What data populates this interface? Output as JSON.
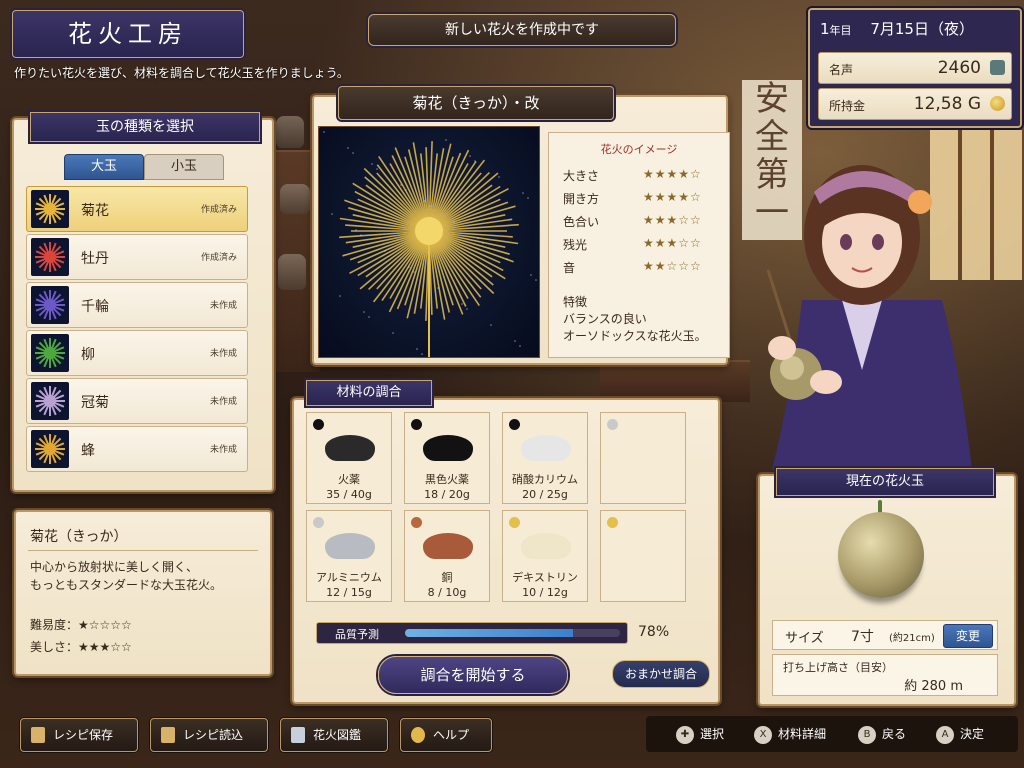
{
  "title": "花火工房",
  "subtitle": "作りたい花火を選び、材料を調合して花火玉を作りましょう。",
  "banner": "新しい花火を作成中です",
  "status": {
    "year": "1",
    "year_unit": "年目",
    "date": "7月15日（夜）",
    "fame_label": "名声",
    "fame_value": "2460",
    "money_label": "所持金",
    "money_value": "12,58 G"
  },
  "left": {
    "title": "玉の種類を選択",
    "tabs": [
      "大玉",
      "小玉"
    ],
    "items": [
      {
        "name": "菊花",
        "state": "作成済み",
        "color": "#e6b43a"
      },
      {
        "name": "牡丹",
        "state": "作成済み",
        "color": "#d9453a"
      },
      {
        "name": "千輪",
        "state": "未作成",
        "color": "#6d58c8"
      },
      {
        "name": "柳",
        "state": "未作成",
        "color": "#4ea83e"
      },
      {
        "name": "冠菊",
        "state": "未作成",
        "color": "#b7a2d2"
      },
      {
        "name": "蜂",
        "state": "未作成",
        "color": "#e0a832"
      }
    ]
  },
  "desc": {
    "name": "菊花（きっか）",
    "text": "中心から放射状に美しく開く、\nもっともスタンダードな大玉花火。",
    "difficulty_label": "難易度：",
    "difficulty_stars": "★☆☆☆☆",
    "beauty_label": "美しさ：",
    "beauty_stars": "★★★☆☆"
  },
  "firework": {
    "name": "菊花（きっか）・改",
    "image_title": "花火のイメージ",
    "attrs": [
      {
        "label": "大きさ",
        "stars": "★★★★☆"
      },
      {
        "label": "開き方",
        "stars": "★★★★☆"
      },
      {
        "label": "色合い",
        "stars": "★★★☆☆"
      },
      {
        "label": "残光",
        "stars": "★★★☆☆"
      },
      {
        "label": "音",
        "stars": "★★☆☆☆"
      }
    ],
    "feature_title": "特徴",
    "feature_text": "バランスの良い\nオーソドックスな花火玉。"
  },
  "mix": {
    "title": "材料の調合",
    "materials": [
      {
        "name": "火薬",
        "qty": "35 / 40g",
        "dot": "#111111",
        "pile": "#2a2a2a"
      },
      {
        "name": "黒色火薬",
        "qty": "18 / 20g",
        "dot": "#111111",
        "pile": "#121212"
      },
      {
        "name": "硝酸カリウム",
        "qty": "20 / 25g",
        "dot": "#111111",
        "pile": "#e6e6e6"
      },
      {
        "name": "",
        "qty": "",
        "dot": "#c9c9c9",
        "pile": ""
      },
      {
        "name": "アルミニウム",
        "qty": "12 / 15g",
        "dot": "#c9c9c9",
        "pile": "#b8bcc2"
      },
      {
        "name": "銅",
        "qty": "8 / 10g",
        "dot": "#b8683a",
        "pile": "#a85a3a"
      },
      {
        "name": "デキストリン",
        "qty": "10 / 12g",
        "dot": "#e2c04a",
        "pile": "#efe5c8"
      },
      {
        "name": "",
        "qty": "",
        "dot": "#e2c04a",
        "pile": ""
      }
    ],
    "quality_label": "品質予測",
    "quality_value": "78%",
    "quality_fraction": 0.78,
    "start_button": "調合を開始する",
    "auto_button": "おまかせ調合"
  },
  "current": {
    "title": "現在の花火玉",
    "size_label": "サイズ",
    "size_value": "7寸",
    "size_detail": "(約21cm)",
    "change_button": "変更",
    "height_label": "打ち上げ高さ（目安）",
    "height_value": "約 280 m"
  },
  "bottom_buttons": [
    {
      "label": "レシピ保存",
      "icon": "save-icon"
    },
    {
      "label": "レシピ読込",
      "icon": "load-icon"
    },
    {
      "label": "花火図鑑",
      "icon": "book-icon"
    },
    {
      "label": "ヘルプ",
      "icon": "help-icon"
    }
  ],
  "hints": [
    {
      "key": "✚",
      "label": "選択"
    },
    {
      "key": "X",
      "label": "材料詳細"
    },
    {
      "key": "B",
      "label": "戻る"
    },
    {
      "key": "A",
      "label": "決定"
    }
  ],
  "background_text": "安全第一"
}
